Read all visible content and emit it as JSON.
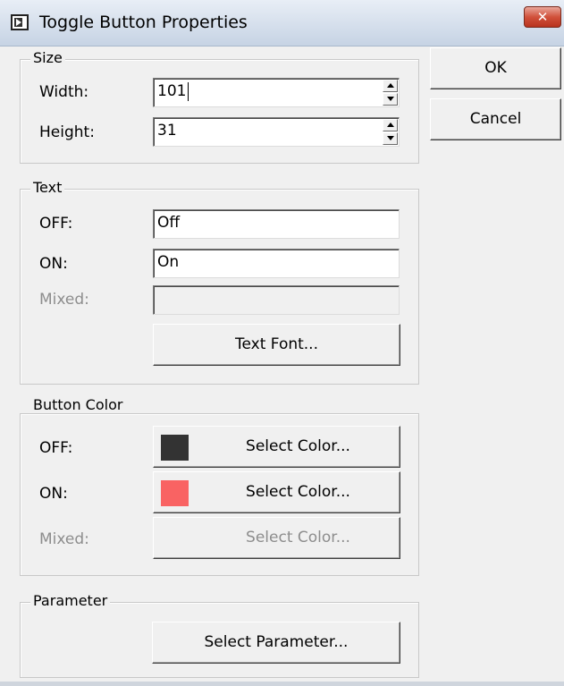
{
  "window": {
    "title": "Toggle Button Properties",
    "close_glyph": "✕"
  },
  "buttons": {
    "ok_label": "OK",
    "cancel_label": "Cancel"
  },
  "size": {
    "legend": "Size",
    "width_label": "Width:",
    "width_value": "101",
    "height_label": "Height:",
    "height_value": "31"
  },
  "text": {
    "legend": "Text",
    "off_label": "OFF:",
    "off_value": "Off",
    "on_label": "ON:",
    "on_value": "On",
    "mixed_label": "Mixed:",
    "mixed_value": "",
    "font_button": "Text Font..."
  },
  "button_color": {
    "legend": "Button Color",
    "off_label": "OFF:",
    "off_color": "#333333",
    "on_label": "ON:",
    "on_color": "#f96363",
    "mixed_label": "Mixed:",
    "select_color_label": "Select Color...",
    "mixed_select_color_label": "Select Color..."
  },
  "parameter": {
    "legend": "Parameter",
    "select_button": "Select Parameter..."
  }
}
